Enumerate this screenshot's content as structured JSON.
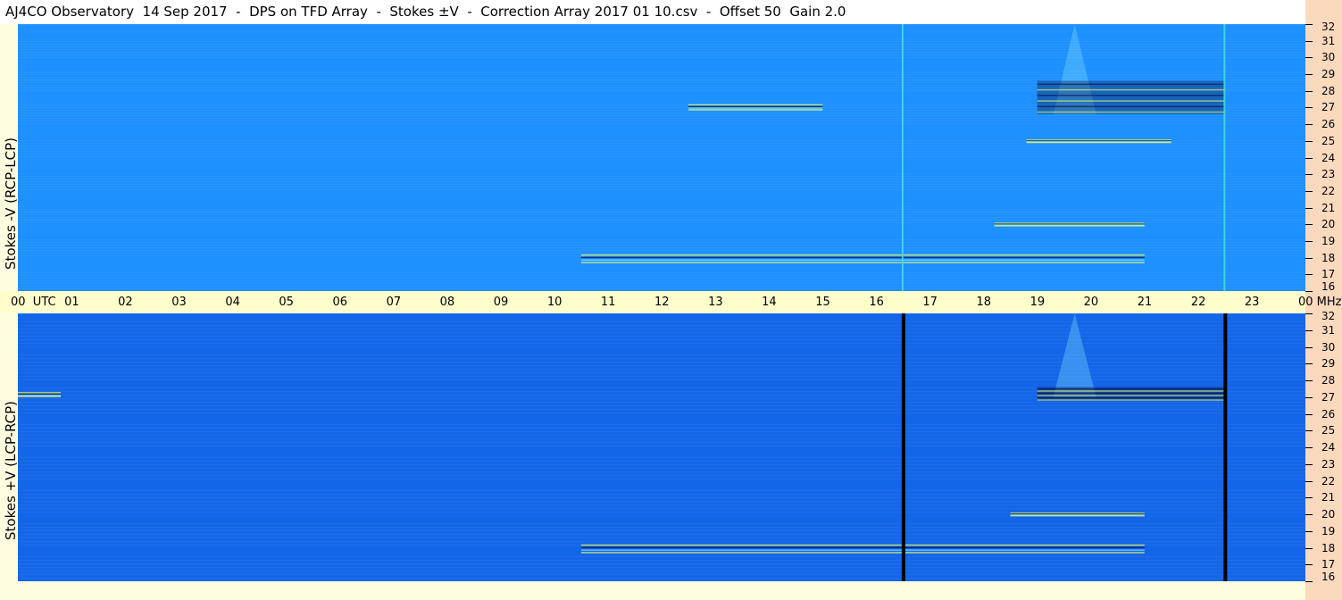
{
  "title": "AJ4CO Observatory  14 Sep 2017  -  DPS on TFD Array  -  Stokes ±V  -  Correction Array 2017 01 10.csv  -  Offset 50  Gain 2.0",
  "colors": {
    "top_background": "#1e90ff",
    "bottom_background": "#1466e8",
    "axis_strip": "#fffdcc",
    "right_strip": "#fbd9bd",
    "emission_light": "#7fe0ff",
    "emission_yellow": "#e8ff6a",
    "emission_dark": "#0a1040"
  },
  "chart_data": [
    {
      "type": "heatmap",
      "name": "Stokes -V (RCP-LCP)",
      "ylabel": "Stokes -V (RCP-LCP)",
      "x_unit": "UTC",
      "x_range": [
        0,
        24
      ],
      "x_ticks": [
        "00",
        "01",
        "02",
        "03",
        "04",
        "05",
        "06",
        "07",
        "08",
        "09",
        "10",
        "11",
        "12",
        "13",
        "14",
        "15",
        "16",
        "17",
        "18",
        "19",
        "20",
        "21",
        "22",
        "23",
        "00"
      ],
      "y_unit": "MHz",
      "y_range": [
        16,
        32
      ],
      "y_ticks": [
        "32",
        "31",
        "30",
        "29",
        "28",
        "27",
        "26",
        "25",
        "24",
        "23",
        "22",
        "21",
        "20",
        "19",
        "18",
        "17",
        "16"
      ],
      "vertical_lines_utc": [
        16.5,
        22.5
      ],
      "vertical_line_style": "light",
      "features": [
        {
          "utc": [
            19.3,
            20.1
          ],
          "mhz": [
            26.6,
            32
          ],
          "kind": "burst-triangle"
        },
        {
          "utc": [
            19.0,
            22.5
          ],
          "mhz": [
            26.6,
            28.6
          ],
          "kind": "burst-band"
        },
        {
          "utc": [
            10.5,
            21.0
          ],
          "mhz": [
            17.6,
            18.2
          ],
          "kind": "horizontal-streak"
        },
        {
          "utc": [
            12.5,
            15.0
          ],
          "mhz": [
            26.8,
            27.2
          ],
          "kind": "horizontal-streak"
        },
        {
          "utc": [
            18.8,
            21.5
          ],
          "mhz": [
            24.9,
            25.1
          ],
          "kind": "horizontal-streak"
        },
        {
          "utc": [
            18.2,
            21.0
          ],
          "mhz": [
            19.9,
            20.1
          ],
          "kind": "horizontal-streak"
        }
      ]
    },
    {
      "type": "heatmap",
      "name": "Stokes +V (LCP-RCP)",
      "ylabel": "Stokes +V (LCP-RCP)",
      "x_unit": "UTC",
      "x_range": [
        0,
        24
      ],
      "y_unit": "MHz",
      "y_range": [
        16,
        32
      ],
      "y_ticks": [
        "32",
        "31",
        "30",
        "29",
        "28",
        "27",
        "26",
        "25",
        "24",
        "23",
        "22",
        "21",
        "20",
        "19",
        "18",
        "17",
        "16"
      ],
      "vertical_lines_utc": [
        16.5,
        22.5
      ],
      "vertical_line_style": "dark",
      "features": [
        {
          "utc": [
            19.3,
            20.1
          ],
          "mhz": [
            27.0,
            32
          ],
          "kind": "burst-triangle"
        },
        {
          "utc": [
            19.0,
            22.5
          ],
          "mhz": [
            26.8,
            27.6
          ],
          "kind": "burst-band"
        },
        {
          "utc": [
            10.5,
            21.0
          ],
          "mhz": [
            17.6,
            18.2
          ],
          "kind": "horizontal-streak"
        },
        {
          "utc": [
            0.0,
            0.8
          ],
          "mhz": [
            27.0,
            27.3
          ],
          "kind": "horizontal-streak"
        },
        {
          "utc": [
            18.5,
            21.0
          ],
          "mhz": [
            19.9,
            20.1
          ],
          "kind": "horizontal-streak"
        }
      ]
    }
  ],
  "xaxis": {
    "left_label": "00  UTC",
    "labels": [
      "01",
      "02",
      "03",
      "04",
      "05",
      "06",
      "07",
      "08",
      "09",
      "10",
      "11",
      "12",
      "13",
      "14",
      "15",
      "16",
      "17",
      "18",
      "19",
      "20",
      "21",
      "22",
      "23"
    ],
    "right_label": "00 MHz"
  }
}
